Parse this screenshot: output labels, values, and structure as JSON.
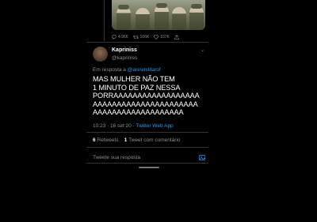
{
  "top_tweet": {
    "actions": [
      {
        "icon": "reply-icon",
        "count": "4.966"
      },
      {
        "icon": "retweet-icon",
        "count": "106K"
      },
      {
        "icon": "like-icon",
        "count": "107K"
      },
      {
        "icon": "share-icon",
        "count": ""
      }
    ]
  },
  "tweet": {
    "name": "Kapriniss",
    "handle": "@kapriniss",
    "reply_prefix": "Em resposta a",
    "reply_mention": "@aresmilitarof",
    "text_lines": [
      "MAS MULHER NÃO TEM",
      "1 MINUTO DE PAZ NESSA",
      "PORRAAAAAAAAAAAAAAAAAA",
      "AAAAAAAAAAAAAAAAAAAAAA",
      "AAAAAAAAAAAAAAAAAAA"
    ],
    "timestamp": "10:23 · 16 set 20 ·",
    "source": "Twitter Web App",
    "retweets_count": "6",
    "retweets_label": "Retweets",
    "comments_count": "1",
    "comments_label": "Tweet com comentário"
  },
  "reply_placeholder": "Tweete sua resposta",
  "colors": {
    "background": "#000000",
    "accent": "#1d9bf0",
    "muted": "#8b8f93",
    "divider": "#2f3336"
  }
}
